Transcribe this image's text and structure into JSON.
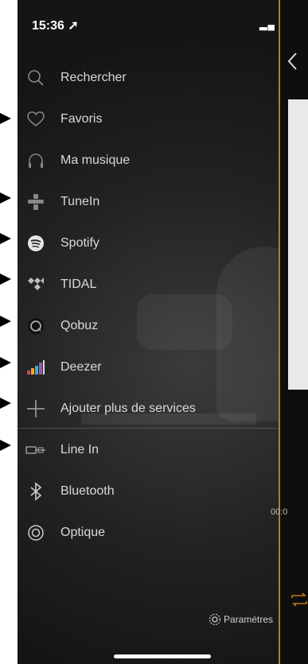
{
  "status_bar": {
    "time": "15:36 ➚",
    "signal_wifi_battery": "▂▄ ᯤ ▭"
  },
  "menu": {
    "items": [
      {
        "label": "Rechercher",
        "icon": "search-icon"
      },
      {
        "label": "Favoris",
        "icon": "heart-icon"
      },
      {
        "label": "Ma musique",
        "icon": "headphones-icon"
      },
      {
        "label": "TuneIn",
        "icon": "tunein-icon"
      },
      {
        "label": "Spotify",
        "icon": "spotify-icon"
      },
      {
        "label": "TIDAL",
        "icon": "tidal-icon"
      },
      {
        "label": "Qobuz",
        "icon": "qobuz-icon"
      },
      {
        "label": "Deezer",
        "icon": "deezer-icon"
      },
      {
        "label": "Ajouter plus de services",
        "icon": "plus-icon"
      },
      {
        "label": "Line In",
        "icon": "line-in-icon"
      },
      {
        "label": "Bluetooth",
        "icon": "bluetooth-icon"
      },
      {
        "label": "Optique",
        "icon": "optical-icon"
      }
    ]
  },
  "settings": {
    "label": "Paramètres",
    "icon": "gear-icon"
  },
  "player_panel": {
    "elapsed_time": "00:0"
  },
  "colors": {
    "accent": "#c07a17",
    "text": "#d9d9d9"
  }
}
